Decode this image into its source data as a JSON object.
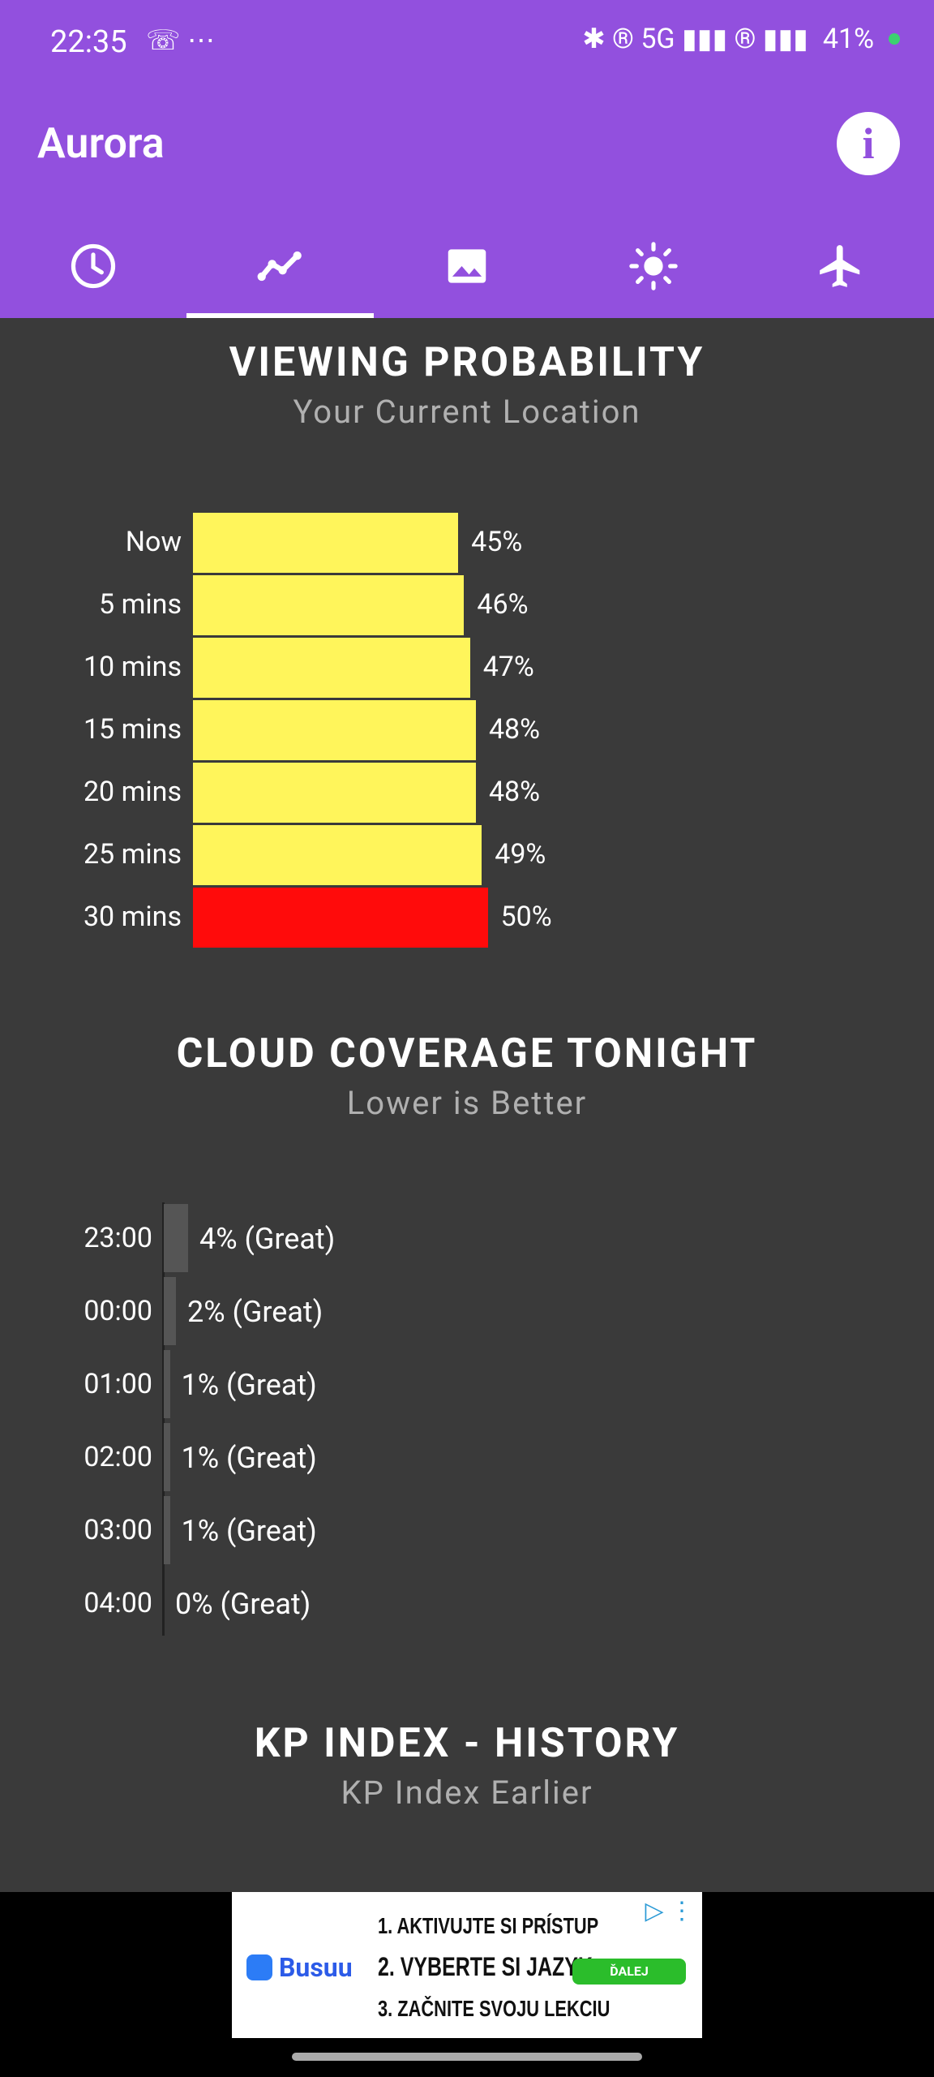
{
  "status_bar": {
    "time": "22:35",
    "left_icons": "☏ ⋯",
    "right_icons": "✱ ® 5G ▮▮▮ ® ▮▮▮",
    "battery": "41%"
  },
  "app": {
    "title": "Aurora",
    "info_label": "i"
  },
  "tabs": [
    {
      "name": "clock-icon",
      "active": false
    },
    {
      "name": "trend-icon",
      "active": true
    },
    {
      "name": "image-icon",
      "active": false
    },
    {
      "name": "sun-icon",
      "active": false
    },
    {
      "name": "plane-icon",
      "active": false
    }
  ],
  "viewing": {
    "title": "VIEWING PROBABILITY",
    "subtitle": "Your Current Location"
  },
  "clouds": {
    "title": "CLOUD COVERAGE TONIGHT",
    "subtitle": "Lower is Better"
  },
  "kp": {
    "title": "KP INDEX - HISTORY",
    "subtitle": "KP Index Earlier"
  },
  "chart_data": [
    {
      "type": "bar",
      "orientation": "horizontal",
      "categories": [
        "Now",
        "5 mins",
        "10 mins",
        "15 mins",
        "20 mins",
        "25 mins",
        "30 mins"
      ],
      "values": [
        45,
        46,
        47,
        48,
        48,
        49,
        50
      ],
      "value_labels": [
        "45%",
        "46%",
        "47%",
        "48%",
        "48%",
        "49%",
        "50%"
      ],
      "colors": [
        "#fff55b",
        "#fff55b",
        "#fff55b",
        "#fff55b",
        "#fff55b",
        "#fff55b",
        "#ff0b0b"
      ],
      "title": "VIEWING PROBABILITY"
    },
    {
      "type": "bar",
      "orientation": "horizontal",
      "categories": [
        "23:00",
        "00:00",
        "01:00",
        "02:00",
        "03:00",
        "04:00"
      ],
      "values": [
        4,
        2,
        1,
        1,
        1,
        0
      ],
      "value_labels": [
        "4% (Great)",
        "2% (Great)",
        "1% (Great)",
        "1% (Great)",
        "1% (Great)",
        "0% (Great)"
      ],
      "title": "CLOUD COVERAGE TONIGHT"
    }
  ],
  "ad": {
    "brand": "Busuu",
    "line1": "1. AKTIVUJTE SI PRÍSTUP",
    "line2": "2. VYBERTE SI JAZYK",
    "line3": "3. ZAČNITE SVOJU LEKCIU",
    "button": "ĎALEJ",
    "choice_icon": "▷ ⋮"
  }
}
